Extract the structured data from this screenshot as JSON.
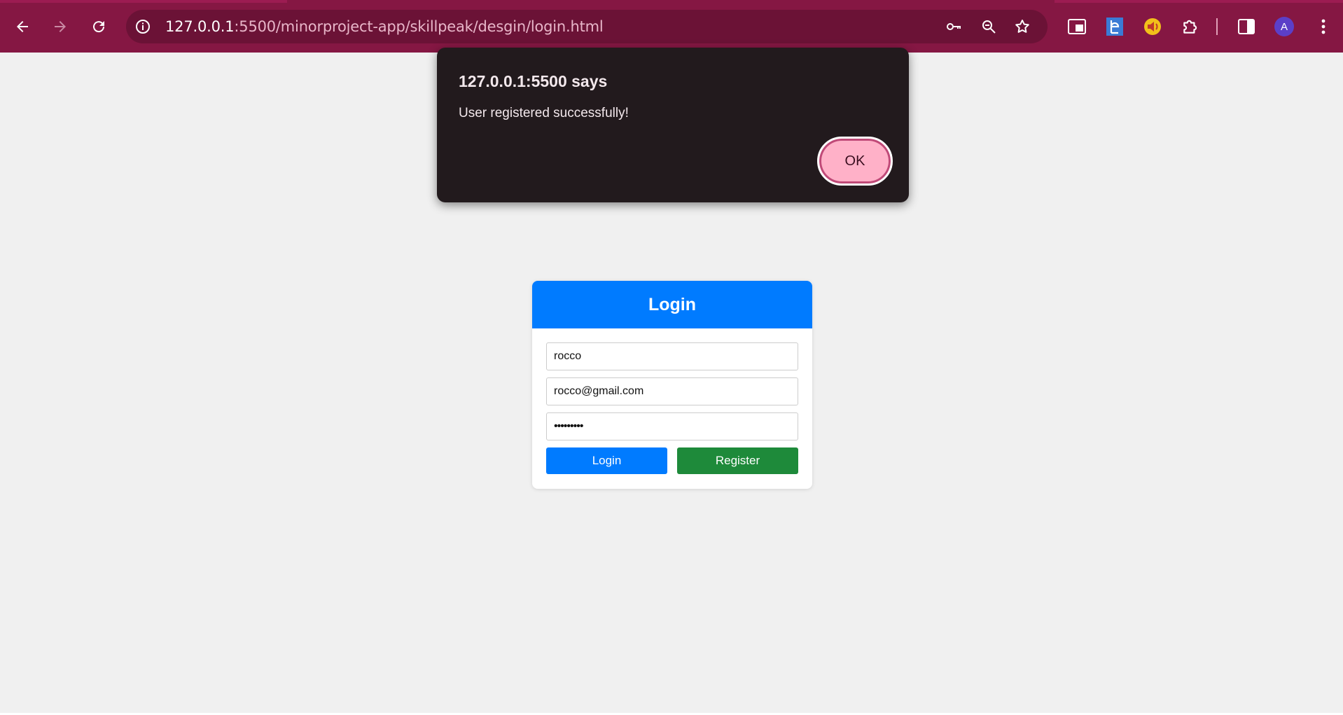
{
  "browser": {
    "url_host": "127.0.0.1",
    "url_path": ":5500/minorproject-app/skillpeak/desgin/login.html",
    "profile_initial": "A",
    "colors": {
      "frame": "#851743",
      "omnibox": "#6b1236"
    },
    "icons": [
      "back-icon",
      "forward-icon",
      "reload-icon",
      "site-info-icon",
      "password-key-icon",
      "zoom-icon",
      "bookmark-star-icon",
      "media-extension-icon",
      "e-extension-icon",
      "audio-extension-icon",
      "extensions-puzzle-icon",
      "side-panel-icon",
      "menu-kebab-icon"
    ]
  },
  "dialog": {
    "title": "127.0.0.1:5500 says",
    "message": "User registered successfully!",
    "ok_label": "OK",
    "colors": {
      "background": "#221a1d",
      "button": "#ffb1c8"
    }
  },
  "login_form": {
    "title": "Login",
    "username_value": "rocco",
    "email_value": "rocco@gmail.com",
    "password_value": "•••••••••",
    "login_label": "Login",
    "register_label": "Register",
    "colors": {
      "primary": "#007bff",
      "success": "#1e8a3a"
    }
  }
}
